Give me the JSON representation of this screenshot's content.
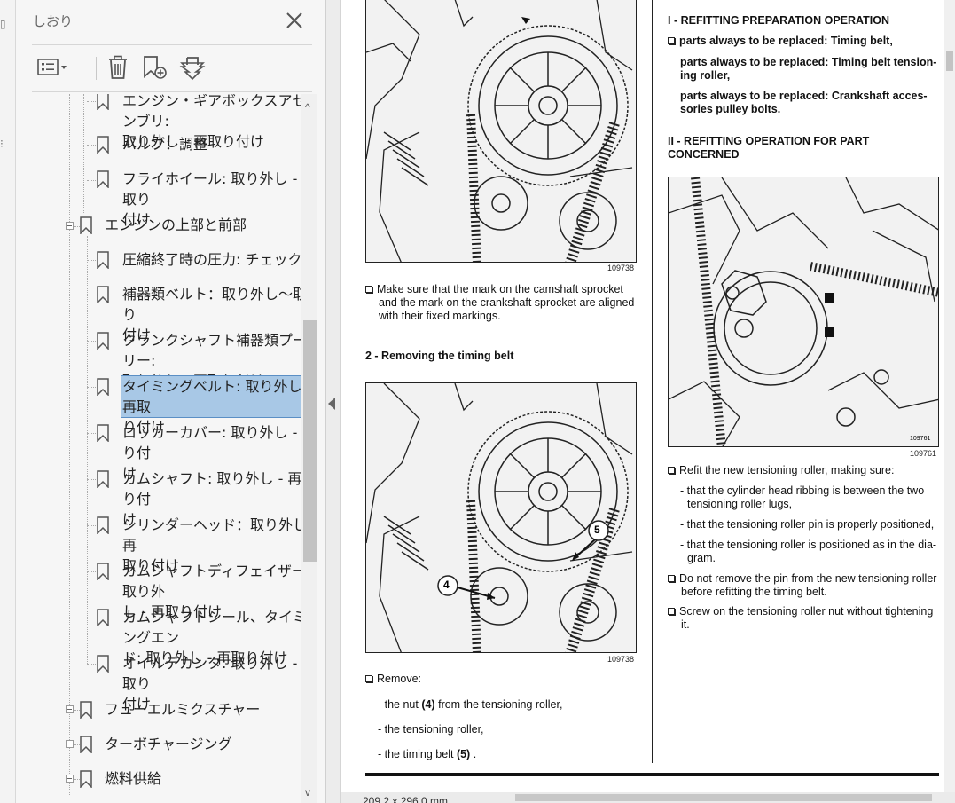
{
  "panel": {
    "title": "しおり"
  },
  "toolbar": {
    "options": "options-menu-icon",
    "delete": "trash-icon",
    "new_bookmark": "new-bookmark-icon",
    "find_bookmark": "find-current-bookmark-icon"
  },
  "bookmarks": [
    {
      "label": "エンジン・ギアボックスアセンブリ: 取り外し - 再取り付け",
      "line1": "エンジン・ギアボックスアセンブリ:",
      "line2": "取り外し - 再取り付け"
    },
    {
      "label": "バルブ：調整"
    },
    {
      "label": "フライホイール: 取り外し - 再取り付け",
      "line1": "フライホイール: 取り外し - 再取り",
      "line2": "付け"
    },
    {
      "label": "エンジンの上部と前部"
    },
    {
      "label": "圧縮終了時の圧力: チェック"
    },
    {
      "label": "補器類ベルト：取り外し～取り付け",
      "line1": "補器類ベルト：取り外し～取り",
      "line2": "付け"
    },
    {
      "label": "クランクシャフト補器類プーリー: 取り外し - 再取り付け",
      "line1": "クランクシャフト補器類プーリー:",
      "line2": "取り外し - 再取り付け"
    },
    {
      "label": "タイミングベルト: 取り外し - 再取り付け",
      "line1": "タイミングベルト: 取り外し - 再取",
      "line2": "り付け"
    },
    {
      "label": "ロッカーカバー: 取り外し - 取り付け",
      "line1": "ロッカーカバー: 取り外し - 取り付",
      "line2": "け"
    },
    {
      "label": "カムシャフト: 取り外し - 再取り付け",
      "line1": "カムシャフト: 取り外し - 再取り付",
      "line2": "け"
    },
    {
      "label": "シリンダーヘッド：取り外し - 再取り付け",
      "line1": "シリンダーヘッド：取り外し - 再",
      "line2": "取り付け"
    },
    {
      "label": "カムシャフトディフェイザー: 取り外し - 再取り付け",
      "line1": "カムシャフトディフェイザー: 取り外",
      "line2": "し - 再取り付け"
    },
    {
      "label": "カムシャフトシール、タイミングエンド: 取り外し - 再取り付け",
      "line1": "カムシャフトシール、タイミングエン",
      "line2": "ド: 取り外し - 再取り付け"
    },
    {
      "label": "オイルデカンタ: 取り外し - 再取り付け",
      "line1": "オイルデカンタ: 取り外し - 再取り",
      "line2": "付け"
    },
    {
      "label": "フューエルミクスチャー"
    },
    {
      "label": "ターボチャージング"
    },
    {
      "label": "燃料供給"
    }
  ],
  "document": {
    "fig1_number": "109738",
    "fig2_number": "109738",
    "fig3_number": "109761",
    "fig3_inner_number": "109761",
    "left": {
      "bullet1_l1": "Make sure that the mark on the camshaft sprocket",
      "bullet1_l2": "and the mark on the crankshaft sprocket are aligned",
      "bullet1_l3": "with their fixed markings.",
      "section2": "2 - Removing the timing belt",
      "callout4": "4",
      "callout5": "5",
      "remove": "Remove:",
      "item1_pre": "- the nut ",
      "item1_bold": "(4)",
      "item1_post": " from the tensioning roller,",
      "item2": "- the tensioning roller,",
      "item3_pre": "- the timing belt ",
      "item3_bold": "(5)",
      "item3_post": " ."
    },
    "right": {
      "heading1": "I - REFITTING PREPARATION OPERATION",
      "replace1": "parts always to be replaced: Timing belt,",
      "replace2_l1": "parts always to be replaced: Timing belt tension-",
      "replace2_l2": "ing roller,",
      "replace3_l1": "parts always to be replaced: Crankshaft acces-",
      "replace3_l2": "sories pulley bolts.",
      "heading2_l1": "II - REFITTING OPERATION FOR PART",
      "heading2_l2": "CONCERNED",
      "refit": "Refit the new tensioning roller, making sure:",
      "sub1_l1": "- that the cylinder head ribbing is between the two",
      "sub1_l2": "tensioning roller lugs,",
      "sub2": "- that the tensioning roller pin is properly positioned,",
      "sub3_l1": "- that the tensioning roller is positioned as in the dia-",
      "sub3_l2": "gram.",
      "note1_l1": "Do not remove the pin from the new tensioning roller",
      "note1_l2": "before refitting the timing belt.",
      "note2_l1": "Screw on the tensioning roller nut without tightening",
      "note2_l2": "it."
    }
  },
  "status": {
    "page_size": "209.2 x 296.0 mm"
  }
}
